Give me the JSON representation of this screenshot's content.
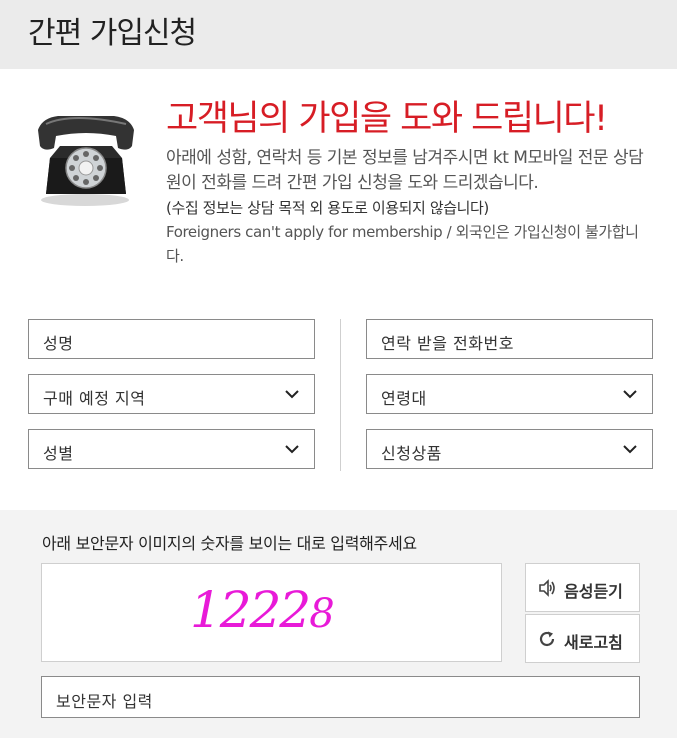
{
  "header": {
    "title": "간편 가입신청"
  },
  "intro": {
    "icon": "telephone-icon",
    "title": "고객님의 가입을 도와 드립니다!",
    "description": "아래에 성함, 연락처 등 기본 정보를 남겨주시면 kt M모바일 전문 상담원이 전화를 드려 간편 가입 신청을 도와 드리겠습니다.",
    "note": "(수집 정보는 상담 목적 외 용도로 이용되지 않습니다)",
    "foreigners": "Foreigners can't apply for membership / 외국인은 가입신청이 불가합니다."
  },
  "form": {
    "name_placeholder": "성명",
    "phone_placeholder": "연락 받을 전화번호",
    "region_select": "구매 예정 지역",
    "age_select": "연령대",
    "gender_select": "성별",
    "product_select": "신청상품"
  },
  "captcha": {
    "instruction": "아래 보안문자 이미지의 숫자를 보이는 대로 입력해주세요",
    "image_text_main": "1222",
    "image_text_tail": "8",
    "audio_label": "음성듣기",
    "refresh_label": "새로고침",
    "input_placeholder": "보안문자 입력",
    "text_color": "#e81ad8"
  },
  "colors": {
    "accent": "#d71d25",
    "header_bg": "#ebebeb"
  }
}
